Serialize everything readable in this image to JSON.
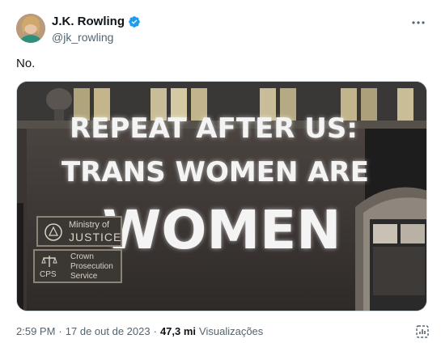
{
  "author": {
    "display_name": "J.K. Rowling",
    "handle": "@jk_rowling",
    "verified_icon": "verified-badge-icon",
    "verified_color": "#1d9bf0"
  },
  "tweet": {
    "text": "No."
  },
  "media": {
    "projection_lines": [
      "REPEAT AFTER US:",
      "TRANS WOMEN ARE",
      "WOMEN"
    ],
    "plaque_justice": [
      "Ministry of",
      "JUSTICE"
    ],
    "plaque_cps_abbr": "CPS",
    "plaque_cps_name": [
      "Crown",
      "Prosecution",
      "Service"
    ]
  },
  "footer": {
    "time": "2:59 PM",
    "sep1": "·",
    "date": "17 de out de 2023",
    "sep2": "·",
    "views_count": "47,3 mi",
    "views_label": "Visualizações"
  },
  "colors": {
    "text_primary": "#0f1419",
    "text_secondary": "#536471",
    "border": "#cfd9de"
  }
}
